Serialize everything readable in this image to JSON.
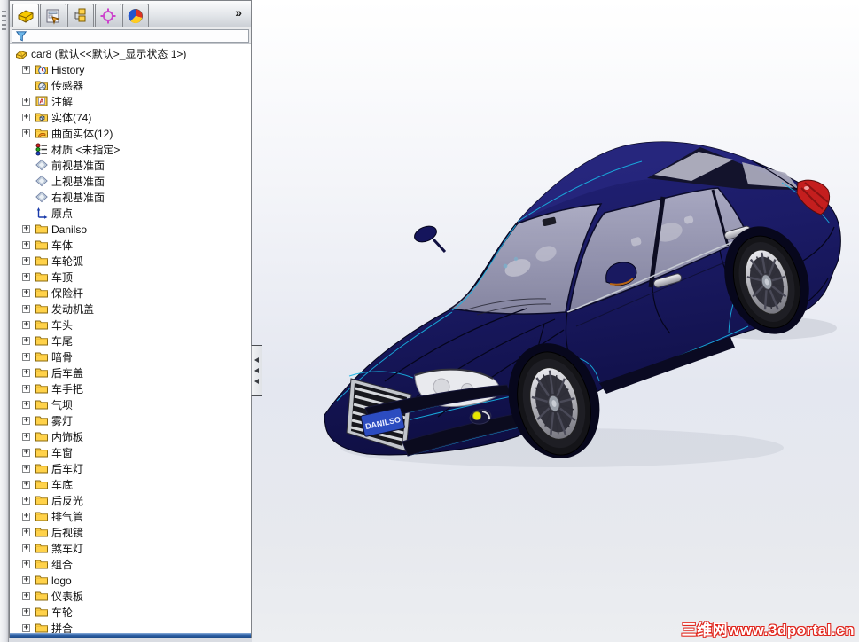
{
  "panel": {
    "tabs": [
      {
        "icon": "featuremanager-tree",
        "active": true
      },
      {
        "icon": "property-manager",
        "active": false
      },
      {
        "icon": "configuration-manager",
        "active": false
      },
      {
        "icon": "dimxpert-manager",
        "active": false
      },
      {
        "icon": "display-manager",
        "active": false
      }
    ],
    "overflow": "»",
    "filter": {
      "value": "",
      "icon": "filter-funnel"
    },
    "tree": {
      "root": {
        "label": "car8  (默认<<默认>_显示状态 1>)",
        "icon": "part"
      },
      "items": [
        {
          "label": "History",
          "icon": "history-folder",
          "expandable": true
        },
        {
          "label": "传感器",
          "icon": "sensors-folder",
          "expandable": false
        },
        {
          "label": "注解",
          "icon": "annotations",
          "expandable": true
        },
        {
          "label": "实体(74)",
          "icon": "solid-bodies-folder",
          "expandable": true
        },
        {
          "label": "曲面实体(12)",
          "icon": "surface-bodies-folder",
          "expandable": true
        },
        {
          "label": "材质 <未指定>",
          "icon": "material",
          "expandable": false
        },
        {
          "label": "前视基准面",
          "icon": "plane",
          "expandable": false
        },
        {
          "label": "上视基准面",
          "icon": "plane",
          "expandable": false
        },
        {
          "label": "右视基准面",
          "icon": "plane",
          "expandable": false
        },
        {
          "label": "原点",
          "icon": "origin",
          "expandable": false
        },
        {
          "label": "Danilso",
          "icon": "folder",
          "expandable": true
        },
        {
          "label": "车体",
          "icon": "folder",
          "expandable": true
        },
        {
          "label": "车轮弧",
          "icon": "folder",
          "expandable": true
        },
        {
          "label": "车顶",
          "icon": "folder",
          "expandable": true
        },
        {
          "label": "保险杆",
          "icon": "folder",
          "expandable": true
        },
        {
          "label": "发动机盖",
          "icon": "folder",
          "expandable": true
        },
        {
          "label": "车头",
          "icon": "folder",
          "expandable": true
        },
        {
          "label": "车尾",
          "icon": "folder",
          "expandable": true
        },
        {
          "label": "暗骨",
          "icon": "folder",
          "expandable": true
        },
        {
          "label": "后车盖",
          "icon": "folder",
          "expandable": true
        },
        {
          "label": "车手把",
          "icon": "folder",
          "expandable": true
        },
        {
          "label": "气坝",
          "icon": "folder",
          "expandable": true
        },
        {
          "label": "雾灯",
          "icon": "folder",
          "expandable": true
        },
        {
          "label": "内饰板",
          "icon": "folder",
          "expandable": true
        },
        {
          "label": "车窗",
          "icon": "folder",
          "expandable": true
        },
        {
          "label": "后车灯",
          "icon": "folder",
          "expandable": true
        },
        {
          "label": "车底",
          "icon": "folder",
          "expandable": true
        },
        {
          "label": "后反光",
          "icon": "folder",
          "expandable": true
        },
        {
          "label": "排气管",
          "icon": "folder",
          "expandable": true
        },
        {
          "label": "后视镜",
          "icon": "folder",
          "expandable": true
        },
        {
          "label": "煞车灯",
          "icon": "folder",
          "expandable": true
        },
        {
          "label": "组合",
          "icon": "folder",
          "expandable": true
        },
        {
          "label": "logo",
          "icon": "folder",
          "expandable": true
        },
        {
          "label": "仪表板",
          "icon": "folder",
          "expandable": true
        },
        {
          "label": "车轮",
          "icon": "folder",
          "expandable": true
        },
        {
          "label": "拼合",
          "icon": "folder",
          "expandable": true
        }
      ]
    }
  },
  "viewport": {
    "watermark": "三维网www.3dportal.cn",
    "model": {
      "type": "3d-car-sedan",
      "license_plate": "DANILSO"
    }
  },
  "colors": {
    "car_body": "#1b1b66",
    "edge_highlight": "#18b4e4",
    "watermark_red": "#e0241b",
    "panel_splitter_blue": "#2f62a8",
    "taillight_red": "#c41e1e",
    "fog_light_yellow": "#e8e800",
    "license_plate_blue": "#2c4cc0"
  }
}
